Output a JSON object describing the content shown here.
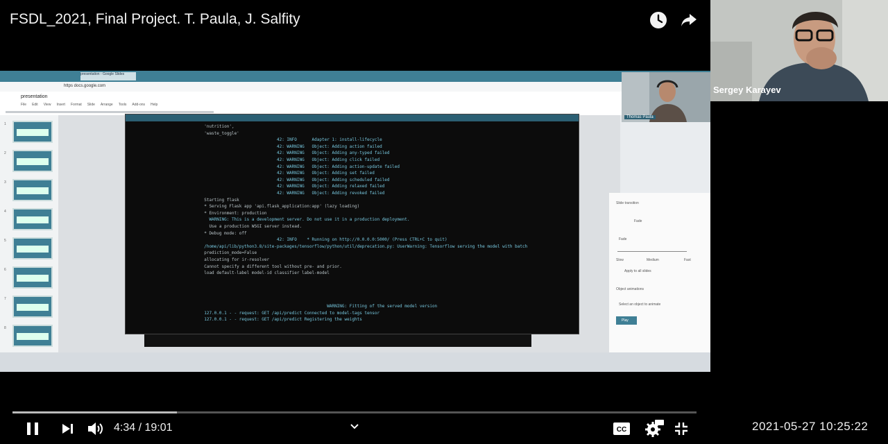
{
  "video": {
    "title": "FSDL_2021, Final Project. T. Paula, J. Salfity",
    "current_time": "4:34",
    "duration": "19:01",
    "time_display": "4:34 / 19:01",
    "progress": 0.24,
    "timestamp": "2021-05-27  10:25:22"
  },
  "speaker": {
    "name": "Sergey Karayev"
  },
  "presenter_thumb": {
    "name": "Thomas Paula"
  },
  "icons": {
    "watch_later": "clock-icon",
    "share": "share-arrow-icon",
    "pause": "pause-icon",
    "next": "skip-next-icon",
    "volume": "volume-icon",
    "captions": "cc-icon",
    "settings": "gear-hd-icon",
    "exit_fullscreen": "exit-fullscreen-icon",
    "chevron": "chevron-down-icon"
  },
  "colors": {
    "accent": "#3f7f95",
    "terminal_bg": "#0c0c0c",
    "terminal_text": "#b9c4c8",
    "terminal_cyan": "#78c9e0"
  },
  "screen": {
    "browser_tab": "presentation - Google Slides",
    "url": "https  docs.google.com",
    "doc_title": "presentation",
    "menu": [
      "File",
      "Edit",
      "View",
      "Insert",
      "Format",
      "Slide",
      "Arrange",
      "Tools",
      "Add-ons",
      "Help"
    ],
    "slide_numbers": [
      "1",
      "2",
      "3",
      "4",
      "5",
      "6",
      "7",
      "8"
    ],
    "panel": {
      "heading": "Slide transition",
      "effect": "Fade",
      "speed_labels": [
        "Slow",
        "Medium",
        "Fast"
      ],
      "apply_all": "Apply to all slides",
      "object_anim": "Object animations",
      "add_anim": "Select an object to animate",
      "play": "Play"
    },
    "terminal_lines": [
      "  'nutrition',",
      "  'waste_toggle'",
      "                               42: INFO      Adapter 1: install-lifecycle",
      "                               42: WARNING   Object: Adding action failed",
      "                               42: WARNING   Object: Adding any-typed failed",
      "                               42: WARNING   Object: Adding click failed",
      "                               42: WARNING   Object: Adding action-update failed",
      "                               42: WARNING   Object: Adding set failed",
      "                               42: WARNING   Object: Adding scheduled failed",
      "                               42: WARNING   Object: Adding relaxed failed",
      "                               42: WARNING   Object: Adding revoked failed",
      "  Starting flask",
      "  * Serving Flask app 'api.flask_application:app' (lazy loading)",
      "  * Environment: production",
      "    WARNING: This is a development server. Do not use it in a production deployment.",
      "    Use a production WSGI server instead.",
      "  * Debug mode: off",
      "                               42: INFO    * Running on http://0.0.0.0:5000/ (Press CTRL+C to quit)",
      "  /home/api/lib/python3.8/site-packages/tensorflow/python/util/deprecation.py: UserWarning: Tensorflow serving the model with batch",
      "  prediction_mode=False",
      "  allocating for ir-resolver",
      "  Cannot specify a different tool without pre- and prior.",
      "  load default-label model-id classifier label-model",
      "",
      "",
      "",
      "",
      "                                                   WARNING: Fitting of the served model version",
      "  127.0.0.1 - - request: GET /api/predict Connected to model-tags tensor",
      "  127.0.0.1 - - request: GET /api/predict Registering the weights"
    ]
  }
}
